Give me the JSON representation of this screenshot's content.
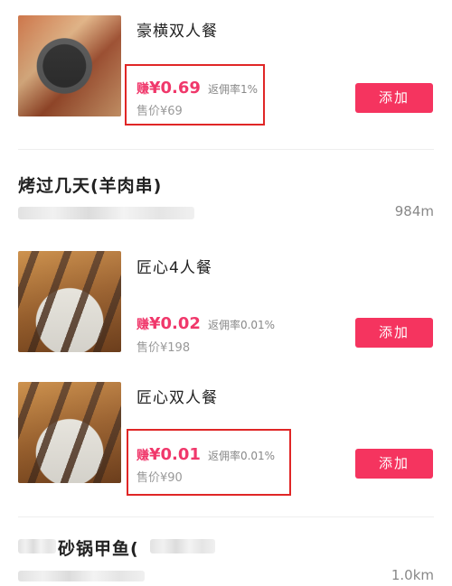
{
  "items": [
    {
      "title": "豪横双人餐",
      "earn_label": "赚",
      "earn_value": "¥0.69",
      "rebate": "返佣率1%",
      "price": "售价¥69",
      "add_label": "添加"
    },
    {
      "title": "匠心4人餐",
      "earn_label": "赚",
      "earn_value": "¥0.02",
      "rebate": "返佣率0.01%",
      "price": "售价¥198",
      "add_label": "添加"
    },
    {
      "title": "匠心双人餐",
      "earn_label": "赚",
      "earn_value": "¥0.01",
      "rebate": "返佣率0.01%",
      "price": "售价¥90",
      "add_label": "添加"
    }
  ],
  "stores": [
    {
      "name": "烤过几天(羊肉串)",
      "distance": "984m"
    },
    {
      "name": "砂锅甲鱼(",
      "distance": "1.0km"
    }
  ],
  "colors": {
    "accent": "#f5345f",
    "earn": "#f0386b",
    "highlight": "#e02626"
  }
}
